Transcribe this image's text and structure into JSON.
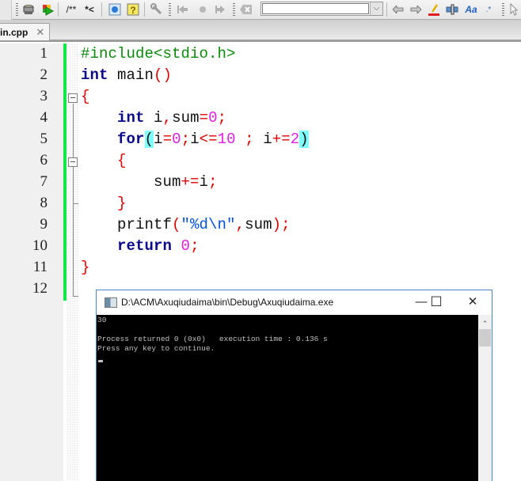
{
  "toolbar": {
    "items": [
      {
        "name": "build-icon",
        "glyph": "🗐"
      },
      {
        "name": "run-icon",
        "glyph": "▶"
      },
      {
        "name": "comment-block-button",
        "label": "/**"
      },
      {
        "name": "comment-line-button",
        "label": "*<"
      },
      {
        "name": "doxyblocks-icon",
        "glyph": "◉"
      },
      {
        "name": "help-icon",
        "glyph": "?"
      },
      {
        "name": "settings-wrench-icon",
        "glyph": "🔧"
      },
      {
        "name": "jump-back-icon",
        "glyph": "⇤"
      },
      {
        "name": "bookmark-dot-icon",
        "glyph": "●"
      },
      {
        "name": "jump-forward-icon",
        "glyph": "⇥"
      },
      {
        "name": "clear-icon",
        "glyph": "⊗"
      },
      {
        "name": "nav-back-icon",
        "glyph": "⇦"
      },
      {
        "name": "nav-forward-icon",
        "glyph": "⇨"
      },
      {
        "name": "highlight-icon",
        "glyph": "✎"
      },
      {
        "name": "selection-icon",
        "glyph": "⌶"
      },
      {
        "name": "match-case-icon",
        "label": "Aa"
      },
      {
        "name": "regex-icon",
        "label": ".*"
      },
      {
        "name": "pointer-icon",
        "glyph": "↖"
      }
    ],
    "search_value": "",
    "combo_arrow": "⌵"
  },
  "tab": {
    "label": "in.cpp",
    "close": "✕"
  },
  "editor": {
    "line_numbers": [
      "1",
      "2",
      "3",
      "4",
      "5",
      "6",
      "7",
      "8",
      "9",
      "10",
      "11",
      "12"
    ],
    "lines": [
      [
        {
          "t": "#include<stdio.h>",
          "c": "pp"
        }
      ],
      [
        {
          "t": "int",
          "c": "kw"
        },
        {
          "t": " main"
        },
        {
          "t": "()",
          "c": "op"
        }
      ],
      [
        {
          "t": "{",
          "c": "op"
        }
      ],
      [
        {
          "t": "    "
        },
        {
          "t": "int",
          "c": "kw"
        },
        {
          "t": " i"
        },
        {
          "t": ",",
          "c": "op"
        },
        {
          "t": "sum"
        },
        {
          "t": "=",
          "c": "op"
        },
        {
          "t": "0",
          "c": "num"
        },
        {
          "t": ";",
          "c": "op"
        }
      ],
      [
        {
          "t": "    "
        },
        {
          "t": "for",
          "c": "kw"
        },
        {
          "t": "(",
          "c": "brace-hl"
        },
        {
          "t": "i"
        },
        {
          "t": "=",
          "c": "op"
        },
        {
          "t": "0",
          "c": "num"
        },
        {
          "t": ";",
          "c": "op"
        },
        {
          "t": "i"
        },
        {
          "t": "<=",
          "c": "op"
        },
        {
          "t": "10",
          "c": "num"
        },
        {
          "t": " "
        },
        {
          "t": ";",
          "c": "op"
        },
        {
          "t": " i"
        },
        {
          "t": "+=",
          "c": "op"
        },
        {
          "t": "2",
          "c": "num"
        },
        {
          "t": ")",
          "c": "brace-hl"
        }
      ],
      [
        {
          "t": "    "
        },
        {
          "t": "{",
          "c": "op"
        }
      ],
      [
        {
          "t": "        sum"
        },
        {
          "t": "+=",
          "c": "op"
        },
        {
          "t": "i"
        },
        {
          "t": ";",
          "c": "op"
        }
      ],
      [
        {
          "t": "    "
        },
        {
          "t": "}",
          "c": "op"
        }
      ],
      [
        {
          "t": "    printf"
        },
        {
          "t": "(",
          "c": "op"
        },
        {
          "t": "\"%d\\n\"",
          "c": "str"
        },
        {
          "t": ",",
          "c": "op"
        },
        {
          "t": "sum"
        },
        {
          "t": ")",
          "c": "op"
        },
        {
          "t": ";",
          "c": "op"
        }
      ],
      [
        {
          "t": "    "
        },
        {
          "t": "return",
          "c": "kw"
        },
        {
          "t": " "
        },
        {
          "t": "0",
          "c": "num"
        },
        {
          "t": ";",
          "c": "op"
        }
      ],
      [
        {
          "t": "}",
          "c": "op"
        }
      ],
      []
    ]
  },
  "console": {
    "title": "D:\\ACM\\Axuqiudaima\\bin\\Debug\\Axuqiudaima.exe",
    "minimize": "—",
    "maximize": "☐",
    "close": "✕",
    "output": [
      "30",
      "",
      "Process returned 0 (0x0)   execution time : 0.136 s",
      "Press any key to continue."
    ],
    "scroll_up": "⌃"
  }
}
